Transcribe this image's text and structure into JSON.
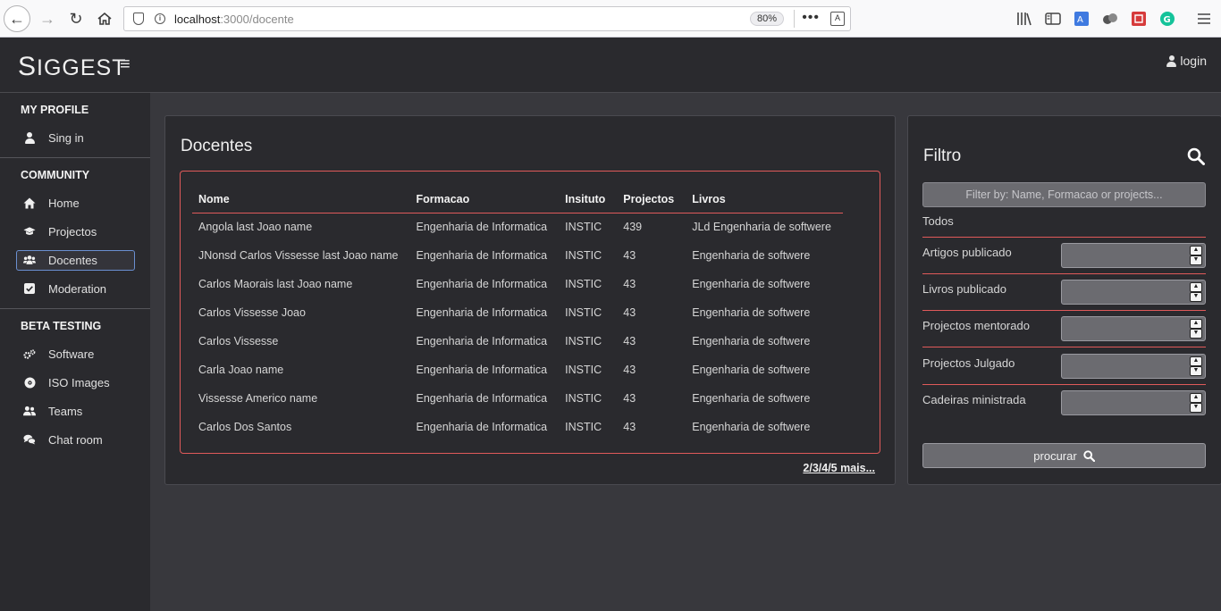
{
  "browser": {
    "url_host": "localhost",
    "url_path": ":3000/docente",
    "zoom": "80%",
    "more": "•••"
  },
  "header": {
    "logo_first": "S",
    "logo_rest": "IGGEST",
    "menu_glyph": "≡",
    "login_label": "login"
  },
  "sidebar": {
    "sections": [
      {
        "title": "MY PROFILE",
        "items": [
          {
            "label": "Sing in",
            "icon": "user-icon"
          }
        ]
      },
      {
        "title": "COMMUNITY",
        "items": [
          {
            "label": "Home",
            "icon": "home-icon"
          },
          {
            "label": "Projectos",
            "icon": "graduation-cap-icon"
          },
          {
            "label": "Docentes",
            "icon": "users-icon",
            "active": true
          },
          {
            "label": "Moderation",
            "icon": "check-square-icon"
          }
        ]
      },
      {
        "title": "BETA TESTING",
        "items": [
          {
            "label": "Software",
            "icon": "cogs-icon"
          },
          {
            "label": "ISO Images",
            "icon": "compact-disc-icon"
          },
          {
            "label": "Teams",
            "icon": "user-friends-icon"
          },
          {
            "label": "Chat room",
            "icon": "comments-icon"
          }
        ]
      }
    ]
  },
  "docentes": {
    "title": "Docentes",
    "columns": [
      "Nome",
      "Formacao",
      "Insituto",
      "Projectos",
      "Livros"
    ],
    "rows": [
      [
        "Angola last Joao name",
        "Engenharia de Informatica",
        "INSTIC",
        "439",
        "JLd Engenharia de softwere"
      ],
      [
        "JNonsd Carlos Vissesse last Joao name",
        "Engenharia de Informatica",
        "INSTIC",
        "43",
        "Engenharia de softwere"
      ],
      [
        "Carlos Maorais last Joao name",
        "Engenharia de Informatica",
        "INSTIC",
        "43",
        "Engenharia de softwere"
      ],
      [
        "Carlos Vissesse Joao",
        "Engenharia de Informatica",
        "INSTIC",
        "43",
        "Engenharia de softwere"
      ],
      [
        "Carlos Vissesse",
        "Engenharia de Informatica",
        "INSTIC",
        "43",
        "Engenharia de softwere"
      ],
      [
        "Carla Joao name",
        "Engenharia de Informatica",
        "INSTIC",
        "43",
        "Engenharia de softwere"
      ],
      [
        "Vissesse Americo name",
        "Engenharia de Informatica",
        "INSTIC",
        "43",
        "Engenharia de softwere"
      ],
      [
        "Carlos Dos Santos",
        "Engenharia de Informatica",
        "INSTIC",
        "43",
        "Engenharia de softwere"
      ]
    ],
    "pager": "2/3/4/5 mais..."
  },
  "filtro": {
    "title": "Filtro",
    "placeholder": "Filter by: Name, Formacao or projects...",
    "todos": "Todos",
    "rows": [
      {
        "label": "Artigos publicado"
      },
      {
        "label": "Livros publicado"
      },
      {
        "label": "Projectos mentorado"
      },
      {
        "label": "Projectos Julgado"
      },
      {
        "label": "Cadeiras ministrada"
      }
    ],
    "button": "procurar"
  },
  "colors": {
    "accent_red": "#e05a5a",
    "panel": "#2a2a2e",
    "background": "#38383d",
    "active_outline": "#6a8fd0"
  }
}
